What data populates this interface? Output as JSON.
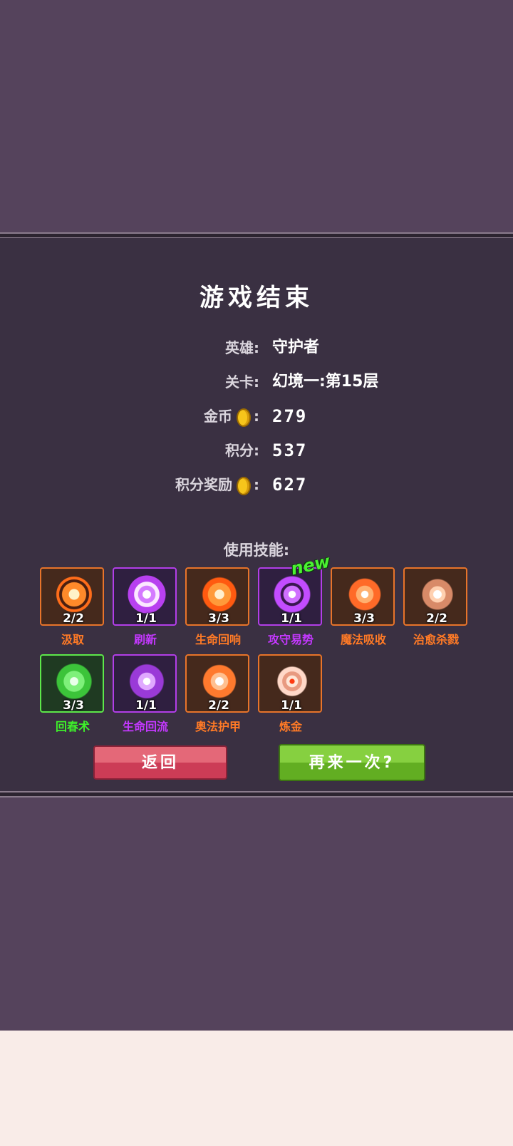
{
  "title": "游戏结束",
  "stats": {
    "hero_label": "英雄:",
    "hero_value": "守护者",
    "stage_label": "关卡:",
    "stage_value": "幻境一:第15层",
    "gold_label": "金币",
    "gold_colon": ":",
    "gold_value": "279",
    "score_label": "积分:",
    "score_value": "537",
    "reward_label": "积分奖励",
    "reward_colon": ":",
    "reward_value": "627"
  },
  "skills_label": "使用技能:",
  "new_tag": "new",
  "skills": [
    {
      "name": "汲取",
      "count": "2/2",
      "color": "orange"
    },
    {
      "name": "刷新",
      "count": "1/1",
      "color": "purple"
    },
    {
      "name": "生命回响",
      "count": "3/3",
      "color": "orange"
    },
    {
      "name": "攻守易势",
      "count": "1/1",
      "color": "purple"
    },
    {
      "name": "魔法吸收",
      "count": "3/3",
      "color": "orange"
    },
    {
      "name": "治愈杀戮",
      "count": "2/2",
      "color": "orange"
    },
    {
      "name": "回春术",
      "count": "3/3",
      "color": "green"
    },
    {
      "name": "生命回流",
      "count": "1/1",
      "color": "purple"
    },
    {
      "name": "奥法护甲",
      "count": "2/2",
      "color": "orange"
    },
    {
      "name": "炼金",
      "count": "1/1",
      "color": "orange"
    }
  ],
  "buttons": {
    "back": "返回",
    "again": "再来一次?"
  },
  "colors": {
    "background": "#55435c",
    "panel": "#3a3042",
    "orange": "#ff7a26",
    "purple": "#c438ff",
    "green": "#3ef02a",
    "coin": "#f6c51b"
  }
}
